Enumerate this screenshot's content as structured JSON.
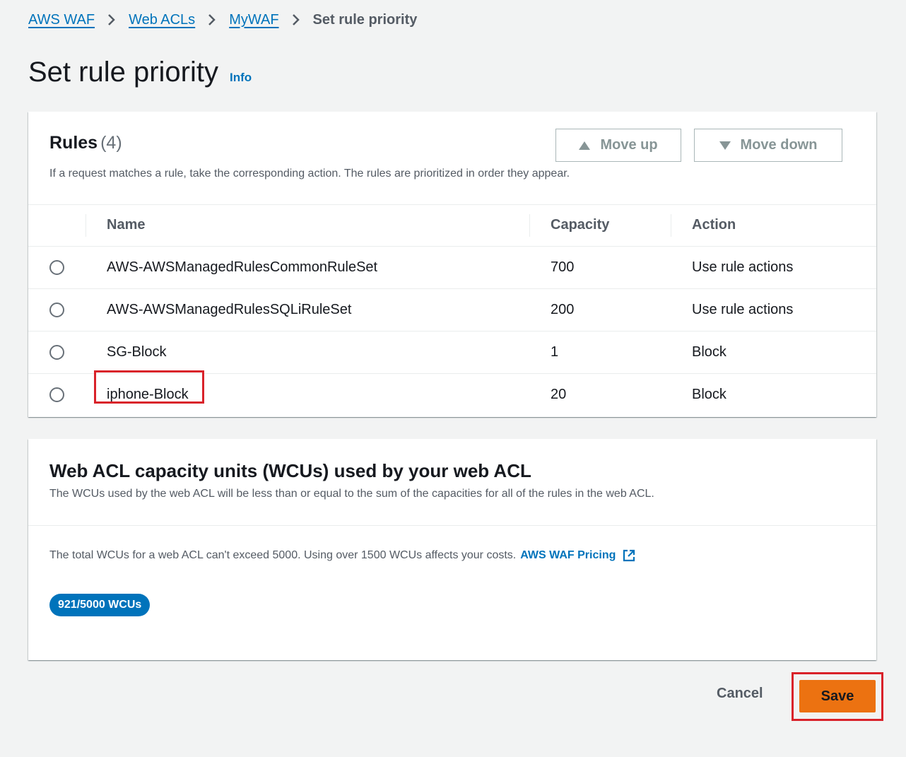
{
  "breadcrumb": {
    "items": [
      "AWS WAF",
      "Web ACLs",
      "MyWAF"
    ],
    "current": "Set rule priority"
  },
  "page": {
    "title": "Set rule priority",
    "info_label": "Info"
  },
  "rules": {
    "title": "Rules",
    "count": "(4)",
    "description": "If a request matches a rule, take the corresponding action. The rules are prioritized in order they appear.",
    "move_up_label": "Move up",
    "move_down_label": "Move down",
    "columns": [
      "Name",
      "Capacity",
      "Action"
    ],
    "rows": [
      {
        "name": "AWS-AWSManagedRulesCommonRuleSet",
        "capacity": "700",
        "action": "Use rule actions"
      },
      {
        "name": "AWS-AWSManagedRulesSQLiRuleSet",
        "capacity": "200",
        "action": "Use rule actions"
      },
      {
        "name": "SG-Block",
        "capacity": "1",
        "action": "Block"
      },
      {
        "name": "iphone-Block",
        "capacity": "20",
        "action": "Block"
      }
    ]
  },
  "wcu": {
    "title": "Web ACL capacity units (WCUs) used by your web ACL",
    "description": "The WCUs used by the web ACL will be less than or equal to the sum of the capacities for all of the rules in the web ACL.",
    "note": "The total WCUs for a web ACL can't exceed 5000. Using over 1500 WCUs affects your costs.",
    "pricing_link": "AWS WAF Pricing",
    "badge": "921/5000 WCUs"
  },
  "footer": {
    "cancel_label": "Cancel",
    "save_label": "Save"
  },
  "colors": {
    "link": "#0073bb",
    "primary_button": "#ec7211",
    "highlight": "#d9222a",
    "background": "#f2f3f3"
  }
}
